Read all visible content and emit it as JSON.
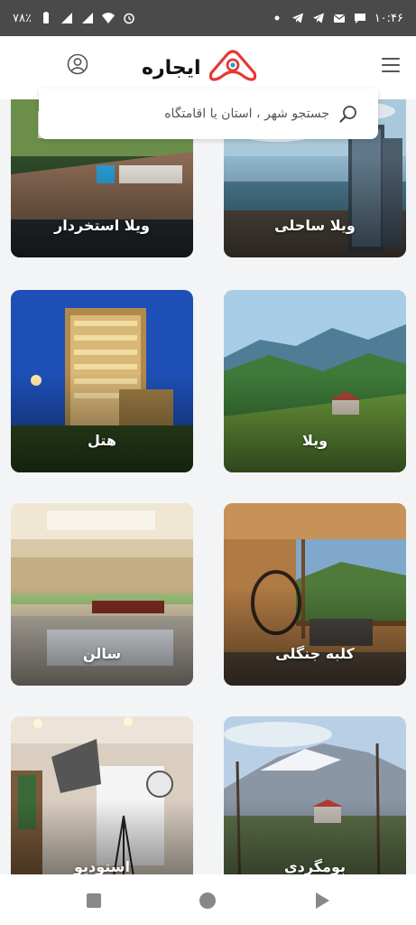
{
  "status_bar": {
    "time": "۱۰:۴۶",
    "battery": "۷۸٪"
  },
  "header": {
    "logo_text": "ایجاره",
    "accent_color": "#e53935"
  },
  "search": {
    "placeholder": "جستجو شهر ، استان یا اقامتگاه"
  },
  "categories": [
    {
      "label": "ویلا ساحلی"
    },
    {
      "label": "ویلا استخردار"
    },
    {
      "label": "ویلا"
    },
    {
      "label": "هتل"
    },
    {
      "label": "کلبه جنگلی"
    },
    {
      "label": "سالن"
    },
    {
      "label": "بومگردی"
    },
    {
      "label": "استودیو"
    }
  ],
  "nav": {
    "icons": [
      "recent-apps-icon",
      "home-icon",
      "back-icon"
    ]
  }
}
